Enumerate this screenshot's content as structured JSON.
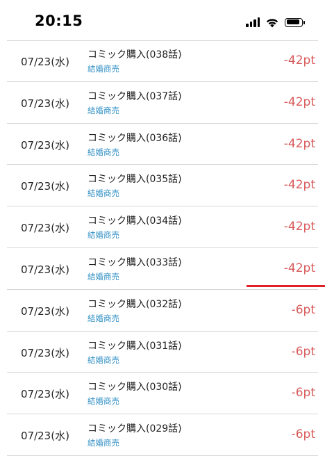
{
  "status_bar": {
    "time": "20:15",
    "icons": [
      "signal-icon",
      "wifi-icon",
      "battery-icon"
    ]
  },
  "colors": {
    "amount": "#d85a5a",
    "series_link": "#2f8fc4",
    "highlight_line": "#e0202a"
  },
  "history": [
    {
      "date": "07/23(水)",
      "title": "コミック購入(038話)",
      "series": "結婚商売",
      "amount": "-42pt"
    },
    {
      "date": "07/23(水)",
      "title": "コミック購入(037話)",
      "series": "結婚商売",
      "amount": "-42pt"
    },
    {
      "date": "07/23(水)",
      "title": "コミック購入(036話)",
      "series": "結婚商売",
      "amount": "-42pt"
    },
    {
      "date": "07/23(水)",
      "title": "コミック購入(035話)",
      "series": "結婚商売",
      "amount": "-42pt"
    },
    {
      "date": "07/23(水)",
      "title": "コミック購入(034話)",
      "series": "結婚商売",
      "amount": "-42pt"
    },
    {
      "date": "07/23(水)",
      "title": "コミック購入(033話)",
      "series": "結婚商売",
      "amount": "-42pt"
    },
    {
      "date": "07/23(水)",
      "title": "コミック購入(032話)",
      "series": "結婚商売",
      "amount": "-6pt"
    },
    {
      "date": "07/23(水)",
      "title": "コミック購入(031話)",
      "series": "結婚商売",
      "amount": "-6pt"
    },
    {
      "date": "07/23(水)",
      "title": "コミック購入(030話)",
      "series": "結婚商売",
      "amount": "-6pt"
    },
    {
      "date": "07/23(水)",
      "title": "コミック購入(029話)",
      "series": "結婚商売",
      "amount": "-6pt"
    }
  ]
}
